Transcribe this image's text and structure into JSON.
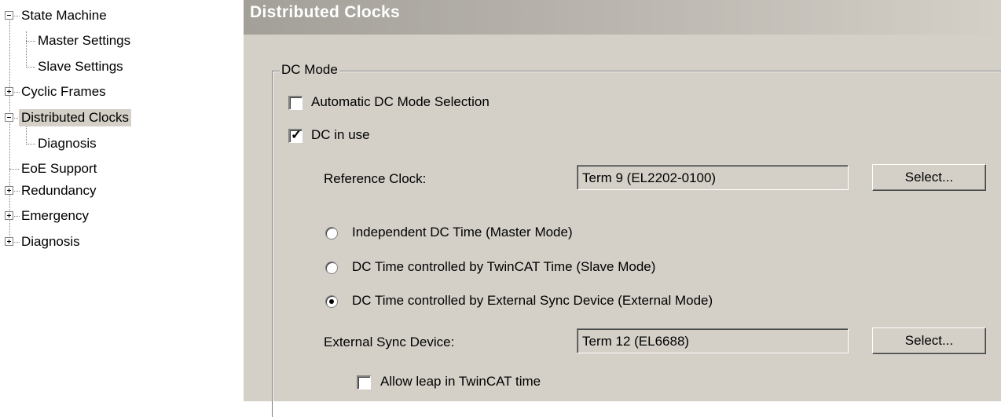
{
  "tree": {
    "items": [
      {
        "label": "State Machine"
      },
      {
        "label": "Master Settings"
      },
      {
        "label": "Slave Settings"
      },
      {
        "label": "Cyclic Frames"
      },
      {
        "label": "Distributed Clocks"
      },
      {
        "label": "Diagnosis"
      },
      {
        "label": "EoE Support"
      },
      {
        "label": "Redundancy"
      },
      {
        "label": "Emergency"
      },
      {
        "label": "Diagnosis"
      }
    ]
  },
  "panel": {
    "title": "Distributed Clocks",
    "group_label": "DC Mode",
    "auto_dc_label": "Automatic DC Mode Selection",
    "auto_dc_checked": false,
    "dc_in_use_label": "DC in use",
    "dc_in_use_checked": true,
    "reference_clock_label": "Reference Clock:",
    "reference_clock_value": "Term 9 (EL2202-0100)",
    "select_label": "Select...",
    "radio_independent_label": "Independent DC Time (Master Mode)",
    "radio_twincat_label": "DC Time controlled by TwinCAT Time (Slave Mode)",
    "radio_external_label": "DC Time controlled by External Sync Device (External Mode)",
    "selected_mode": "DC Time controlled by External Sync Device (External Mode)",
    "external_sync_label": "External Sync Device:",
    "external_sync_value": "Term 12 (EL6688)",
    "allow_leap_label": "Allow leap in TwinCAT time",
    "allow_leap_checked": false
  }
}
